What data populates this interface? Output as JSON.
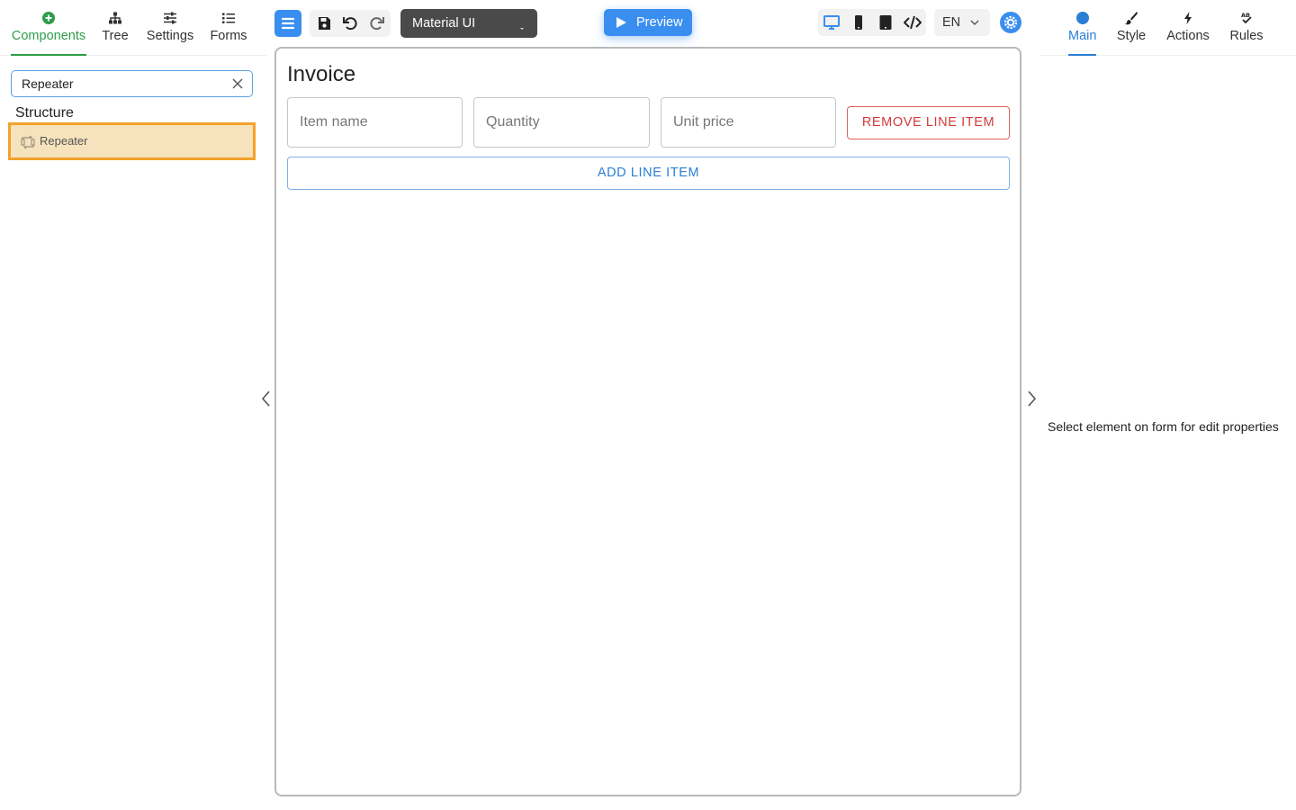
{
  "left_panel": {
    "tabs": [
      {
        "label": "Components",
        "icon": "plus-circle-icon",
        "active": true
      },
      {
        "label": "Tree",
        "icon": "tree-icon"
      },
      {
        "label": "Settings",
        "icon": "sliders-icon"
      },
      {
        "label": "Forms",
        "icon": "list-icon"
      }
    ],
    "search": {
      "value": "Repeater"
    },
    "section_title": "Structure",
    "components": [
      {
        "label": "Repeater",
        "icon": "repeater-icon",
        "selected": true
      }
    ]
  },
  "toolbar": {
    "theme_select": {
      "value": "Material UI"
    },
    "preview_label": "Preview",
    "language": "EN"
  },
  "canvas": {
    "form_title": "Invoice",
    "fields": [
      {
        "placeholder": "Item name"
      },
      {
        "placeholder": "Quantity"
      },
      {
        "placeholder": "Unit price"
      }
    ],
    "remove_label": "REMOVE LINE ITEM",
    "add_label": "ADD LINE ITEM"
  },
  "right_panel": {
    "tabs": [
      {
        "label": "Main",
        "icon": "circle-icon",
        "active": true
      },
      {
        "label": "Style",
        "icon": "brush-icon"
      },
      {
        "label": "Actions",
        "icon": "lightning-icon"
      },
      {
        "label": "Rules",
        "icon": "ab-check-icon"
      }
    ],
    "hint": "Select element on form for edit properties"
  },
  "colors": {
    "accent_green": "#2e9d47",
    "accent_blue": "#3a8ef0",
    "selection_orange": "#f2a22c",
    "danger_red": "#d33a3a"
  }
}
